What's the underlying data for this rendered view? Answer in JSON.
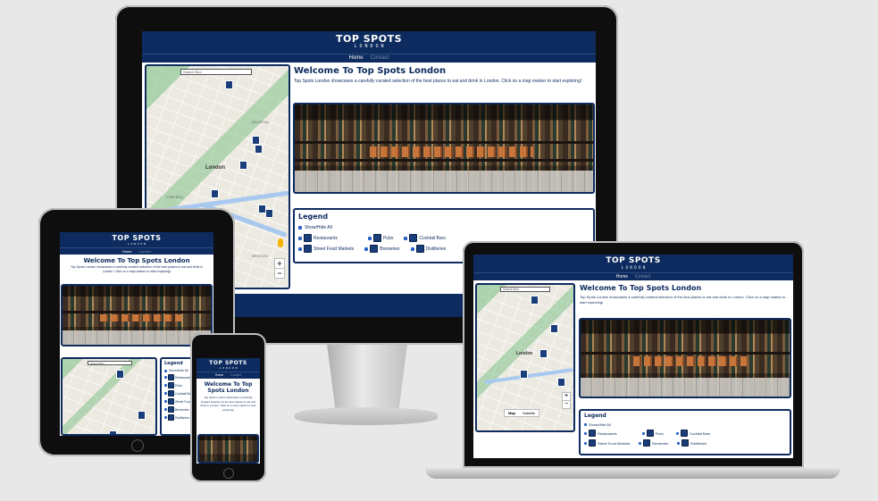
{
  "site": {
    "logo_title": "TOP SPOTS",
    "logo_sub": "L O N D O N",
    "nav": {
      "home": "Home",
      "contact": "Contact"
    },
    "heading": "Welcome To Top Spots London",
    "heading_wrap1": "Welcome To Top",
    "heading_wrap2": "Spots London",
    "intro": "Top Spots London showcases a carefully curated selection of the best places to eat and drink in London. Click on a map marker to start exploring!",
    "search_placeholder": "Search Box",
    "zoom_in": "+",
    "zoom_out": "−",
    "map_toggle": {
      "map": "Map",
      "satellite": "Satellite"
    },
    "map_labels": [
      "DALSTON",
      "London",
      "CHELSEA",
      "BRIXTON",
      "HOLBORN",
      "CAMDEN"
    ],
    "legend": {
      "title": "Legend",
      "show_hide": "Show/Hide All",
      "items": [
        "Restaurants",
        "Pubs",
        "Cocktail Bars",
        "Street Food Markets",
        "Breweries",
        "Distilleries"
      ]
    }
  },
  "colors": {
    "brand_navy": "#0d2b5e",
    "checkbox_blue": "#2b64c8",
    "background": "#e8e8e8"
  }
}
